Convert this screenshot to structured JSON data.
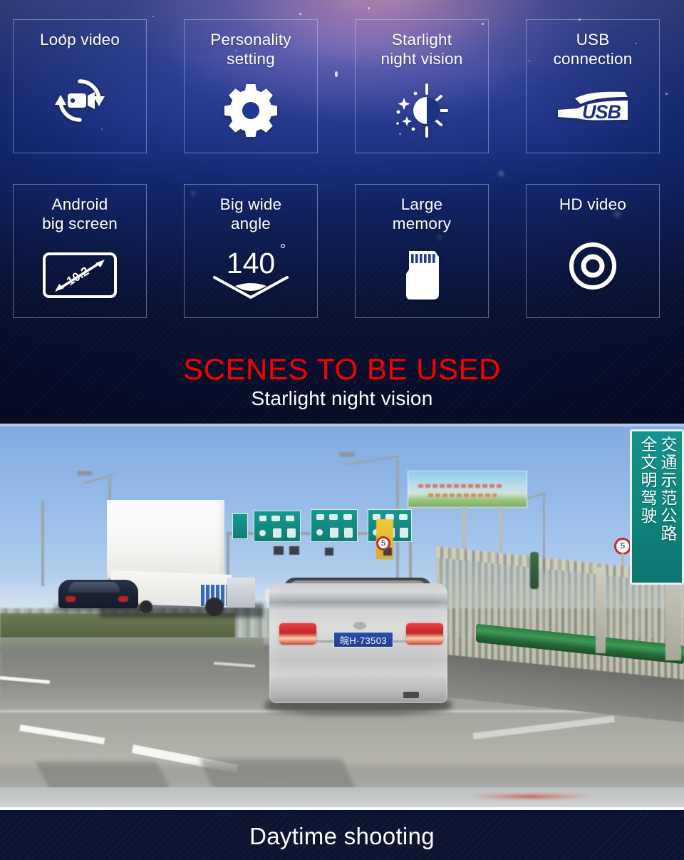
{
  "features": {
    "tiles": [
      {
        "label": "Loop video",
        "icon": "loop-video-icon"
      },
      {
        "label": "Personality\nsetting",
        "icon": "gear-icon"
      },
      {
        "label": "Starlight\nnight vision",
        "icon": "starlight-night-vision-icon"
      },
      {
        "label": "USB\nconnection",
        "icon": "usb-icon"
      },
      {
        "label": "Android\nbig screen",
        "icon": "screen-size-icon",
        "icon_text": "10.2"
      },
      {
        "label": "Big wide\nangle",
        "icon": "wide-angle-icon",
        "icon_text": "140",
        "icon_sup": "°"
      },
      {
        "label": "Large\nmemory",
        "icon": "microsd-card-icon"
      },
      {
        "label": "HD video",
        "icon": "lens-icon"
      }
    ]
  },
  "heading": {
    "title": "SCENES TO BE USED",
    "subtitle": "Starlight night vision",
    "title_color": "#f90000",
    "subtitle_color": "#ffffff"
  },
  "photo": {
    "caption": "Daytime shooting",
    "license_plate": "皖H·73503",
    "roadside_sign_line1": "交通示范公路",
    "roadside_sign_line2": "全文明驾驶",
    "speed_limit_1": "5",
    "speed_limit_2": "5"
  },
  "colors": {
    "panel_top": "#4b5aa8",
    "panel_bottom": "#070f2b",
    "banner": "#0d1430",
    "accent_red": "#f90000",
    "tile_border": "rgba(205,215,245,0.45)"
  }
}
